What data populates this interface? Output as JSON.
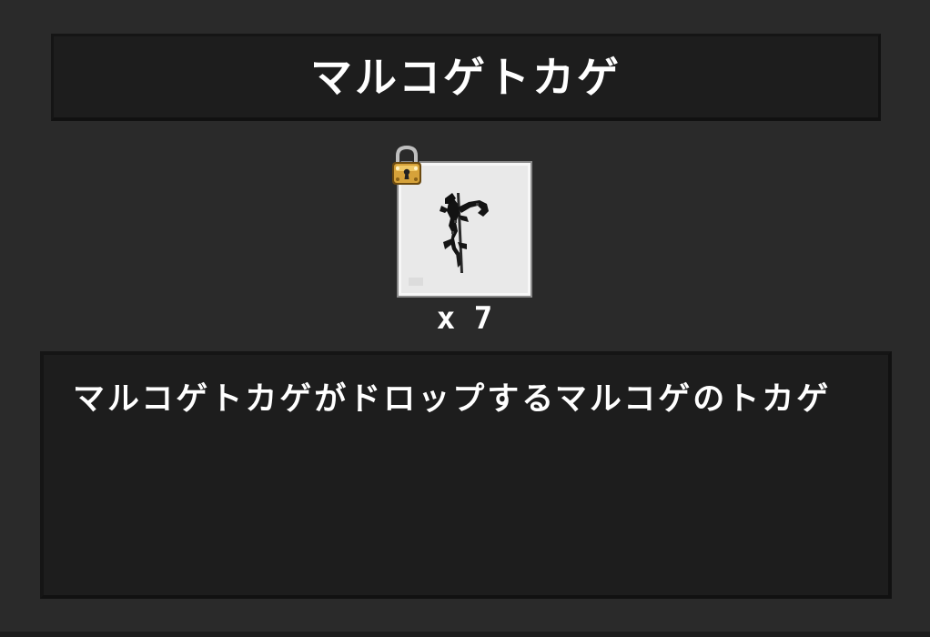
{
  "item": {
    "name": "マルコゲトカゲ",
    "count": "x 7",
    "description": "マルコゲトカゲがドロップするマルコゲのトカゲ",
    "icon": "burnt-lizard-icon",
    "locked": true,
    "lock_icon": "padlock-icon"
  },
  "colors": {
    "background": "#2a2a2a",
    "panel": "#1d1d1d",
    "slot": "#e9e9e9",
    "text": "#ffffff",
    "lock_gold": "#d6a23a"
  }
}
